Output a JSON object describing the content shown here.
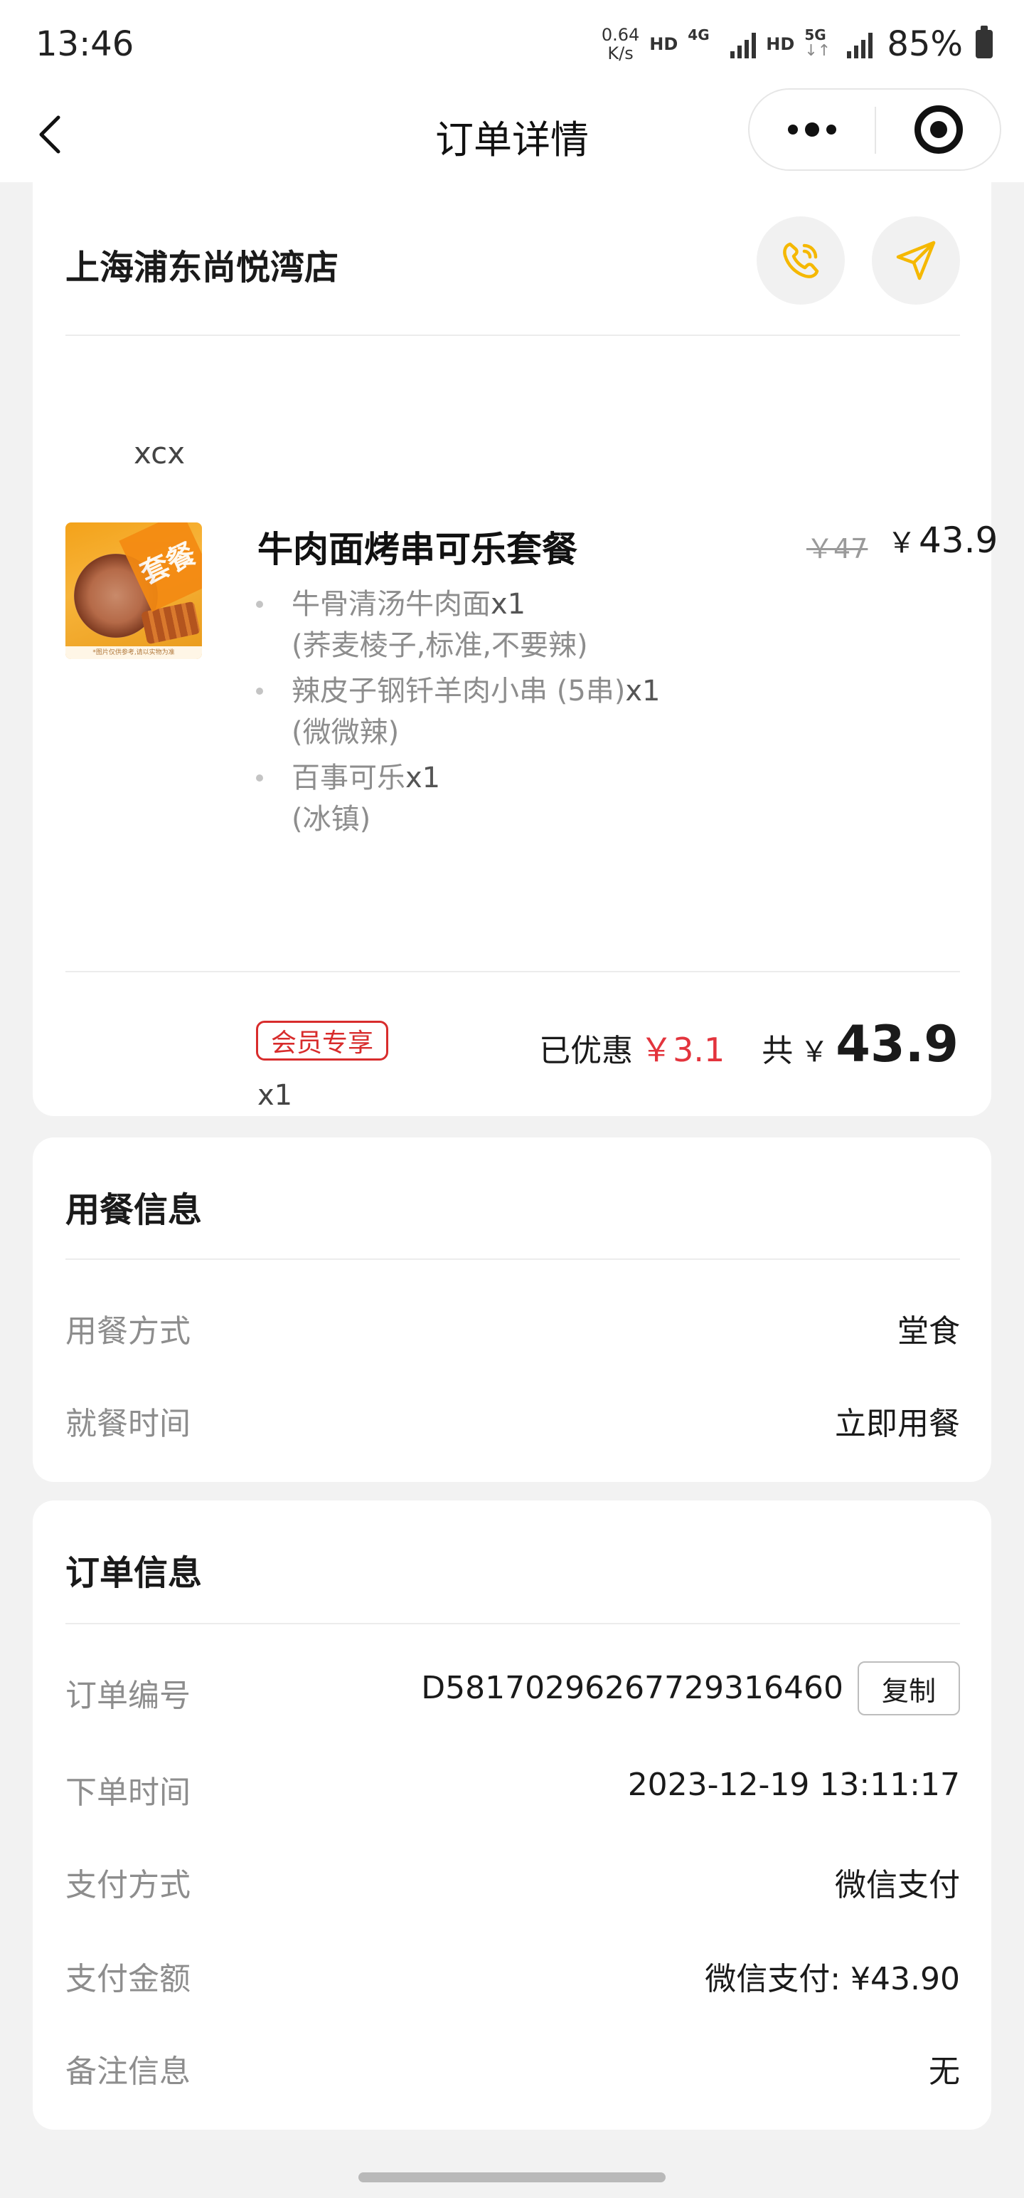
{
  "status_bar": {
    "time": "13:46",
    "speed_value": "0.64",
    "speed_unit": "K/s",
    "hd1": "HD",
    "net1": "4G",
    "hd2": "HD",
    "net2": "5G",
    "net2_arrows": "↓↑",
    "battery": "85%"
  },
  "navbar": {
    "title": "订单详情"
  },
  "store": {
    "name": "上海浦东尚悦湾店",
    "source": "xcx",
    "product": {
      "name": "牛肉面烤串可乐套餐",
      "image_tag": "套餐",
      "image_strip": "*图片仅供参考,请以实物为准",
      "original_price": "￥47",
      "currency": "￥",
      "price": "43.9",
      "items": [
        {
          "name": "牛骨清汤牛肉面",
          "qty": "x1",
          "options": "(荞麦棱子,标准,不要辣)"
        },
        {
          "name": "辣皮子钢钎羊肉小串 (5串)",
          "qty": "x1",
          "options": "(微微辣)"
        },
        {
          "name": "百事可乐",
          "qty": "x1",
          "options": "(冰镇)"
        }
      ],
      "member_tag": "会员专享",
      "quantity": "x1"
    },
    "discount_label": "已优惠",
    "discount_value": "￥3.1",
    "total_label": "共",
    "total_currency": "￥",
    "total_value": "43.9"
  },
  "dining": {
    "title": "用餐信息",
    "rows": [
      {
        "label": "用餐方式",
        "value": "堂食"
      },
      {
        "label": "就餐时间",
        "value": "立即用餐"
      }
    ]
  },
  "order": {
    "title": "订单信息",
    "order_no_label": "订单编号",
    "order_no": "D58170296267729316460",
    "copy_label": "复制",
    "rows": [
      {
        "label": "下单时间",
        "value": "2023-12-19 13:11:17"
      },
      {
        "label": "支付方式",
        "value": "微信支付"
      },
      {
        "label": "支付金额",
        "value": "微信支付: ¥43.90"
      },
      {
        "label": "备注信息",
        "value": "无"
      }
    ]
  },
  "colors": {
    "accent_yellow": "#f5b800",
    "discount_red": "#e3343d",
    "member_red": "#d82c2c",
    "background": "#f2f2f2"
  },
  "icons": {
    "back": "chevron-left-icon",
    "more": "more-dots-icon",
    "close": "target-close-icon",
    "phone": "phone-icon",
    "navigate": "navigation-arrow-icon"
  }
}
